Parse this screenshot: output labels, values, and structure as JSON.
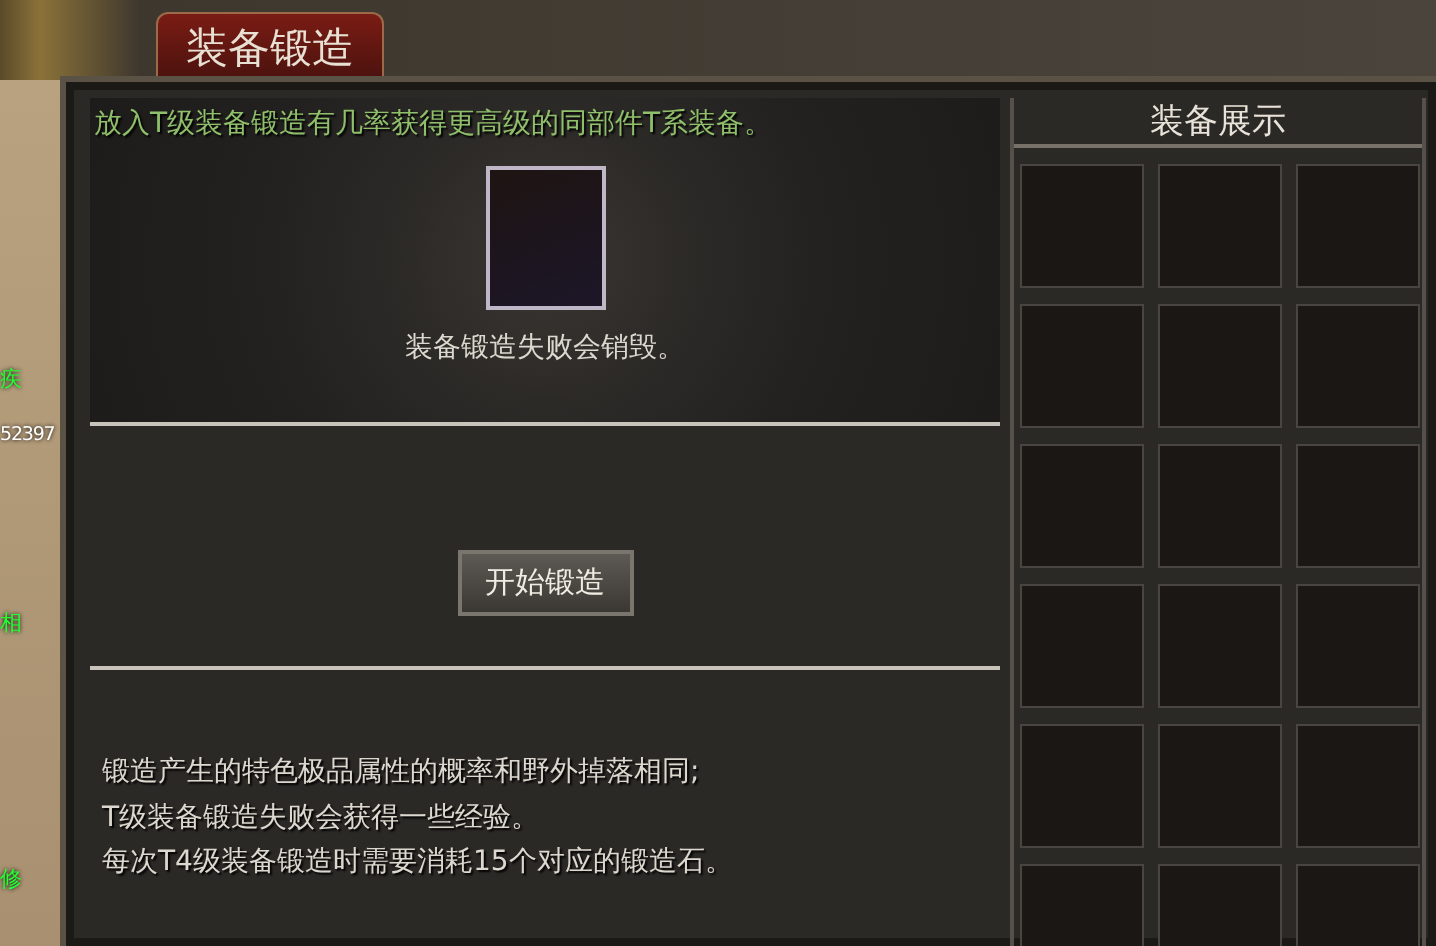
{
  "scene": {
    "labels": [
      {
        "text": "疾",
        "kind": "name"
      },
      {
        "text": "52397",
        "kind": "number"
      },
      {
        "text": "相",
        "kind": "name"
      },
      {
        "text": "修",
        "kind": "name"
      }
    ]
  },
  "window": {
    "title": "装备锻造"
  },
  "forge": {
    "hint": "放入T级装备锻造有几率获得更高级的同部件T系装备。",
    "warning": "装备锻造失败会销毁。",
    "button": "开始锻造",
    "notes": [
      "锻造产生的特色极品属性的概率和野外掉落相同;",
      "T级装备锻造失败会获得一些经验。",
      "每次T4级装备锻造时需要消耗15个对应的锻造石。"
    ]
  },
  "showcase": {
    "title": "装备展示"
  }
}
